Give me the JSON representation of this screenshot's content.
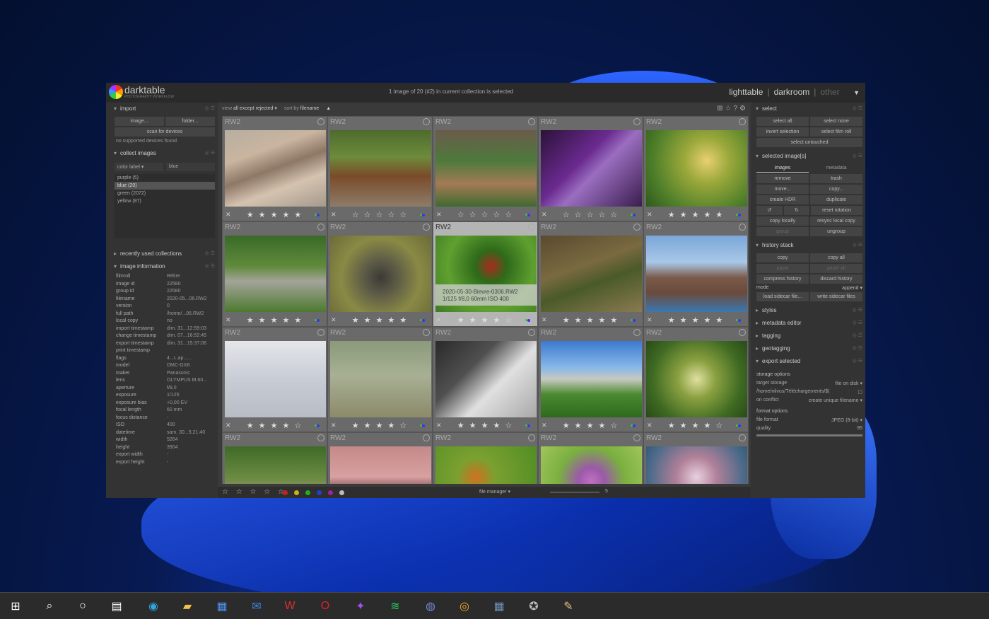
{
  "window": {
    "app_name": "darktable",
    "app_sub": "PHOTOGRAPHY WORKFLOW",
    "selection_info": "1 image of 20 (#2) in current collection is selected",
    "views": [
      "lighttable",
      "darkroom",
      "other"
    ]
  },
  "left": {
    "import": {
      "title": "import",
      "image_btn": "image...",
      "folder_btn": "folder...",
      "scan_btn": "scan for devices",
      "no_devices": "no supported devices found"
    },
    "collect": {
      "title": "collect images",
      "property": "color label",
      "value": "blue",
      "items": [
        "purple (5)",
        "blue (20)",
        "green (2072)",
        "yellow (87)"
      ]
    },
    "recent": {
      "title": "recently used collections"
    },
    "info": {
      "title": "image information",
      "rows": [
        [
          "filmroll",
          "Rétire"
        ],
        [
          "image id",
          "22580"
        ],
        [
          "group id",
          "22580"
        ],
        [
          "filename",
          "2020-05...06.RW2"
        ],
        [
          "version",
          "0"
        ],
        [
          "full path",
          "/home/...06.RW2"
        ],
        [
          "local copy",
          "no"
        ],
        [
          "import timestamp",
          "dim. 31...12:59:03"
        ],
        [
          "change timestamp",
          "dim. 07...16:52:45"
        ],
        [
          "export timestamp",
          "dim. 31...15:37:06"
        ],
        [
          "print timestamp",
          ""
        ],
        [
          "flags",
          "4...r..ap......"
        ],
        [
          "model",
          "DMC-GX8"
        ],
        [
          "maker",
          "Panasonic"
        ],
        [
          "lens",
          "OLYMPUS M.60..."
        ],
        [
          "aperture",
          "f/8,0"
        ],
        [
          "exposure",
          "1/125"
        ],
        [
          "exposure bias",
          "+0,00 EV"
        ],
        [
          "focal length",
          "60 mm"
        ],
        [
          "focus distance",
          "-"
        ],
        [
          "ISO",
          "400"
        ],
        [
          "datetime",
          "sam. 30...5:21:40"
        ],
        [
          "width",
          "5264"
        ],
        [
          "height",
          "3904"
        ],
        [
          "export width",
          "-"
        ],
        [
          "export height",
          "-"
        ]
      ]
    }
  },
  "center": {
    "view_label": "view",
    "view_value": "all except rejected ▾",
    "sort_label": "sort by",
    "sort_value": "filename",
    "sort_dir": "▲",
    "cells": [
      {
        "type": "RW2",
        "stars": "★ ★ ★ ★ ★",
        "thumb": "linear-gradient(160deg,#b7aea1 0%,#c9b5a0 30%,#8d7766 50%,#d5c3b0 70%,#a59a8c 100%)"
      },
      {
        "type": "RW2",
        "stars": "☆ ☆ ☆ ☆ ☆",
        "thumb": "linear-gradient(180deg,#4e6b2e 0%,#6d8b3a 35%,#7a4b2a 60%,#8d7c68 100%)"
      },
      {
        "type": "RW2",
        "stars": "☆ ☆ ☆ ☆ ☆",
        "thumb": "linear-gradient(180deg,#6b5b4b 0%,#4d7a3c 40%,#a47a55 70%,#3f6a2f 100%)"
      },
      {
        "type": "RW2",
        "stars": "☆ ☆ ☆ ☆ ☆",
        "thumb": "linear-gradient(135deg,#2b1238 0%,#6a2a8f 40%,#9a6ec0 55%,#3a1d4d 100%)"
      },
      {
        "type": "RW2",
        "stars": "★ ★ ★ ★ ★",
        "thumb": "radial-gradient(circle at 60% 40%,#e8d070 0%,#9aa83a 30%,#4f7f2a 70%,#2f5a1c 100%)"
      },
      {
        "type": "RW2",
        "stars": "★ ★ ★ ★ ★",
        "thumb": "linear-gradient(180deg,#3a6a28 0%,#5e8a3a 40%,#a4a49a 60%,#4c7a2e 100%)"
      },
      {
        "type": "RW2",
        "stars": "★ ★ ★ ★ ★",
        "thumb": "radial-gradient(circle at 50% 55%,#3c3a36 0%,#5c5a46 25%,#8a8a45 60%,#6a6a38 100%)"
      },
      {
        "type": "RW2",
        "stars": "★ ★ ★ ★ ☆",
        "thumb": "radial-gradient(circle at 55% 40%,#a82a1e 0%,#2e6a1a 22%,#5fa030 60%,#3e7a22 100%)",
        "highlight": true,
        "caption1": "2020-05-30-Bievre-0306.RW2",
        "caption2": "1/125 f/8,0 60mm ISO 400"
      },
      {
        "type": "RW2",
        "stars": "★ ★ ★ ★ ★",
        "thumb": "linear-gradient(160deg,#5a4a30 0%,#7a6a40 40%,#4a5a28 60%,#8a7a50 100%)"
      },
      {
        "type": "RW2",
        "stars": "★ ★ ★ ★ ★",
        "thumb": "linear-gradient(180deg,#7aa6d8 0%,#a8c8e8 35%,#7a5a4a 55%,#6a4a3c 75%,#3a78b0 100%)"
      },
      {
        "type": "RW2",
        "stars": "★ ★ ★ ★ ☆",
        "thumb": "linear-gradient(180deg,#e4e6ea 0%,#c8ccd4 50%,#b8bcc4 100%)"
      },
      {
        "type": "RW2",
        "stars": "★ ★ ★ ★ ☆",
        "thumb": "linear-gradient(180deg,#8a9a7a 0%,#a8b094 45%,#8c8a6a 100%)"
      },
      {
        "type": "RW2",
        "stars": "★ ★ ★ ★ ☆",
        "thumb": "linear-gradient(135deg,#2a2a2a 0%,#505050 35%,#e0e0e0 60%,#a8a8a8 100%)"
      },
      {
        "type": "RW2",
        "stars": "★ ★ ★ ★ ☆",
        "thumb": "linear-gradient(180deg,#3a7ad0 0%,#8ab8e8 35%,#c8c8c0 50%,#4a8a30 70%,#2e6a1e 100%)"
      },
      {
        "type": "RW2",
        "stars": "★ ★ ★ ★ ☆",
        "thumb": "radial-gradient(circle at 50% 50%,#e0e0a0 0%,#8aa040 30%,#3e6a22 70%,#2a4a18 100%)"
      },
      {
        "type": "RW2",
        "stars": "",
        "thumb": "linear-gradient(180deg,#3e6a28 0%,#6a8a40 40%,#9a9880 70%,#5a7a38 100%)"
      },
      {
        "type": "RW2",
        "stars": "",
        "thumb": "linear-gradient(180deg,#c48a8a 0%,#d8a0a0 40%,#6a4048 60%,#3a2830 100%)"
      },
      {
        "type": "RW2",
        "stars": "",
        "thumb": "radial-gradient(circle at 40% 40%,#d07020 0%,#7aa030 25%,#4a8a22 100%)"
      },
      {
        "type": "RW2",
        "stars": "",
        "thumb": "radial-gradient(circle at 50% 45%,#c070c0 0%,#9a5aa8 20%,#7ab040 50%,#a8c860 100%)"
      },
      {
        "type": "RW2",
        "stars": "",
        "thumb": "radial-gradient(circle at 50% 40%,#e8d0e0 0%,#b08098 30%,#4a6a8a 70%,#2a4a6a 100%)"
      }
    ],
    "bottom": {
      "stars": "☆ ☆ ☆ ☆ ☆",
      "colors": [
        "#c82020",
        "#c8b020",
        "#20b020",
        "#2040d0",
        "#a020a0",
        "#bbbbbb"
      ],
      "layout": "file manager",
      "zoom": "5"
    }
  },
  "right": {
    "select": {
      "title": "select",
      "select_all": "select all",
      "select_none": "select none",
      "invert": "invert selection",
      "film_roll": "select film roll",
      "untouched": "select untouched"
    },
    "selected": {
      "title": "selected image[s]",
      "tab_images": "images",
      "tab_metadata": "metadata",
      "remove": "remove",
      "trash": "trash",
      "move": "move...",
      "copy": "copy...",
      "hdr": "create HDR",
      "duplicate": "duplicate",
      "rot_left": "↺",
      "rot_right": "↻",
      "reset_rot": "reset rotation",
      "copy_locally": "copy locally",
      "resync": "resync local copy",
      "group": "group",
      "ungroup": "ungroup"
    },
    "history": {
      "title": "history stack",
      "copy": "copy",
      "copy_all": "copy all",
      "paste": "paste",
      "paste_all": "paste all",
      "compress": "compress history",
      "discard": "discard history",
      "mode_label": "mode",
      "mode_value": "append ▾",
      "load": "load sidecar file...",
      "write": "write sidecar files"
    },
    "modules": [
      "styles",
      "metadata editor",
      "tagging",
      "geotagging"
    ],
    "export": {
      "title": "export selected",
      "storage_head": "storage options",
      "target_label": "target storage",
      "target_value": "file on disk ▾",
      "path": "/home/nilvus/Téléchargements/$(",
      "conflict_label": "on conflict",
      "conflict_value": "create unique filename ▾",
      "format_head": "format options",
      "format_label": "file format",
      "format_value": "JPEG (8-bit) ▾",
      "quality_label": "quality",
      "quality_value": "95"
    }
  },
  "taskbar": {
    "icons": [
      "windows-start-icon",
      "search-icon",
      "cortana-icon",
      "task-view-icon",
      "edge-icon",
      "file-explorer-icon",
      "store-icon",
      "mail-icon",
      "wps-icon",
      "opera-icon",
      "messenger-icon",
      "spotify-icon",
      "discord-icon",
      "chrome-icon",
      "calculator-icon",
      "darktable-taskbar-icon",
      "paint-icon"
    ]
  }
}
